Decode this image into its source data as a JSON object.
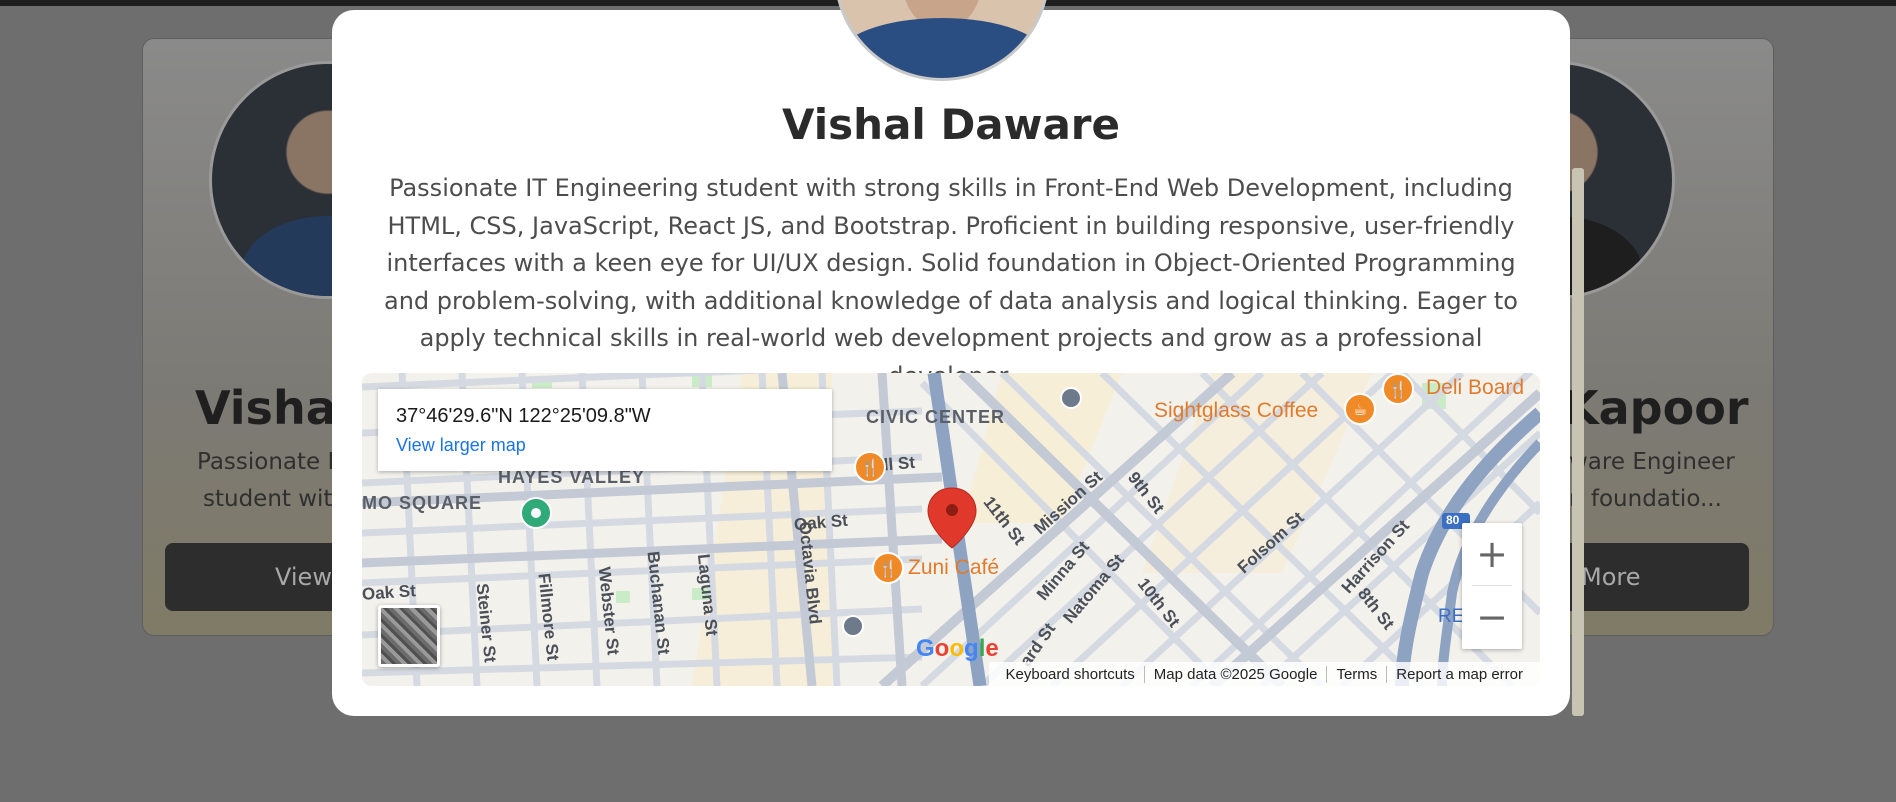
{
  "page": {
    "background_color": "#6e6e6e"
  },
  "background_cards": {
    "left": {
      "name_partial": "Vishal I",
      "bio_line_1": "Passionate IT",
      "bio_line_2": "student with",
      "button_label": "View"
    },
    "right": {
      "name_partial": "Kapoor",
      "bio_line_1": "ware Engineer",
      "bio_line_2": "n foundatio...",
      "button_label": "More"
    }
  },
  "modal": {
    "name": "Vishal Daware",
    "bio": "Passionate IT Engineering student with strong skills in Front-End Web Development, including HTML, CSS, JavaScript, React JS, and Bootstrap. Proficient in building responsive, user-friendly interfaces with a keen eye for UI/UX design. Solid foundation in Object-Oriented Programming and problem-solving, with additional knowledge of data analysis and logical thinking. Eager to apply technical skills in real-world web development projects and grow as a professional developer.",
    "map": {
      "coordinates": "37°46'29.6\"N 122°25'09.8\"W",
      "larger_map_link": "View larger map",
      "zoom_in": "+",
      "zoom_out": "−",
      "google_logo": "Google",
      "attribution": {
        "keyboard_shortcuts": "Keyboard shortcuts",
        "map_data": "Map data ©2025 Google",
        "terms": "Terms",
        "report": "Report a map error"
      },
      "area_labels": {
        "civic_center": "CIVIC CENTER",
        "hayes_valley": "HAYES VALLEY",
        "mo_square": "MO SQUARE"
      },
      "street_labels": {
        "fell": "Fell St",
        "oak_1": "Oak St",
        "oak_2": "Oak St",
        "octavia": "Octavia Blvd",
        "steiner": "Steiner St",
        "fillmore": "Fillmore St",
        "webster": "Webster St",
        "buchanan": "Buchanan St",
        "laguna": "Laguna St",
        "eleventh": "11th St",
        "mission": "Mission St",
        "ninth": "9th St",
        "minna": "Minna St",
        "natoma": "Natoma St",
        "howard": "ard St",
        "tenth": "10th St",
        "folsom": "Folsom St",
        "harrison": "Harrison St",
        "eighth": "8th St",
        "highway": "80",
        "re": "RE"
      },
      "pois": {
        "sightglass": "Sightglass Coffee",
        "deli_board": "Deli Board",
        "zuni": "Zuni Café"
      },
      "icons": {
        "pin": "map-pin-icon",
        "restaurant": "fork-knife-icon",
        "coffee": "coffee-cup-icon",
        "park": "park-icon",
        "transit": "transit-icon"
      },
      "colors": {
        "pin": "#e0392b",
        "poi": "#f08a26",
        "link": "#1a73e8"
      }
    }
  }
}
